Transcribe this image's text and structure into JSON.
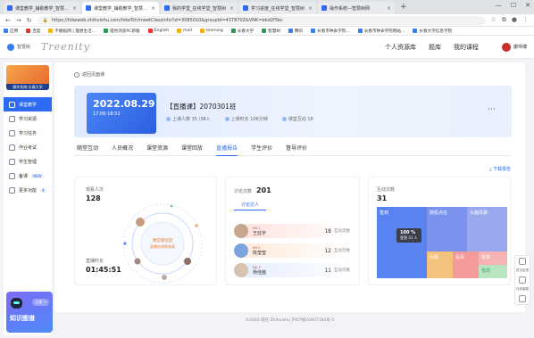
{
  "browser": {
    "tabs": [
      {
        "label": "课堂教学_辅助教学_智慧树网",
        "active": false
      },
      {
        "label": "课堂教学_辅助教学_智慧树网",
        "active": true
      },
      {
        "label": "我的学堂_在线学堂_智慧树",
        "active": false
      },
      {
        "label": "学习进度_在线学堂_智慧树",
        "active": false
      },
      {
        "label": "操作系统—智慧树网",
        "active": false
      }
    ],
    "new_tab": "+",
    "url": "https://hikeweb.zhihuishu.com/hikeTch/meetClassInfo?id=3085010&groupId=4378702&VNK=bbd2f5bc",
    "bookmarks": [
      "应用",
      "百度",
      "不搬稻网 | 理想生活...",
      "猎豹浏览PC新版",
      "English",
      "mail",
      "learning",
      "长春大学",
      "智慧树",
      "腾讯",
      "长春市钟表学院...",
      "长春市钟表学院网站...",
      "长春大学信息学院"
    ]
  },
  "topnav": {
    "logo_text": "智慧树",
    "brand": "Treenity",
    "links": [
      "个人资源库",
      "题库",
      "我的课程"
    ],
    "user_name": "康师傅"
  },
  "sidebar": {
    "course_label": "操作系统-长春大学",
    "items": [
      {
        "label": "课堂教学",
        "active": true,
        "badge": ""
      },
      {
        "label": "学习资源",
        "active": false,
        "badge": ""
      },
      {
        "label": "学习任务",
        "active": false,
        "badge": ""
      },
      {
        "label": "作业考试",
        "active": false,
        "badge": ""
      },
      {
        "label": "学生管理",
        "active": false,
        "badge": ""
      },
      {
        "label": "备课",
        "active": false,
        "badge": "NEW"
      },
      {
        "label": "更多功能",
        "active": false,
        "badge": "4"
      }
    ],
    "promo": {
      "title": "知识图谱",
      "go": "立即 >"
    }
  },
  "main": {
    "back_label": "返回见面课",
    "hero": {
      "date": "2022.08.29",
      "time": "17:06-18:52",
      "title": "【直播课】2070301班",
      "stats": [
        "上课人数 35 /38人",
        "上课时长 106分钟",
        "课堂互动 18"
      ],
      "more": "⋯"
    },
    "tabs": [
      {
        "label": "随堂互动",
        "active": false
      },
      {
        "label": "人员概况",
        "active": false
      },
      {
        "label": "课堂资源",
        "active": false
      },
      {
        "label": "课堂回放",
        "active": false
      },
      {
        "label": "直播报告",
        "active": true
      },
      {
        "label": "学生评价",
        "active": false
      },
      {
        "label": "督导评价",
        "active": false
      }
    ],
    "download": "下载报告",
    "card1": {
      "viewers_label": "观看人次",
      "viewers": "128",
      "duration_label": "直播时长",
      "duration": "01:45:51",
      "center_line1": "课堂受欢迎",
      "center_line2": "直播在线率很高"
    },
    "card2": {
      "label": "讨论次数",
      "count": "201",
      "subtab": "讨论达人",
      "ranks": [
        {
          "no": "NO.1",
          "name": "王廷宇",
          "score": "18",
          "unit": "互动次数"
        },
        {
          "no": "NO.2",
          "name": "陈莹莹",
          "score": "12",
          "unit": "互动次数"
        },
        {
          "no": "NO.3",
          "name": "杨佳茜",
          "score": "11",
          "unit": "互动次数"
        }
      ]
    },
    "card3": {
      "label": "互动次数",
      "count": "31",
      "tooltip_value": "100 %",
      "tooltip_text": "签到 31 人",
      "blocks": [
        "签到",
        "随机点名",
        "头脑风暴",
        "问卷",
        "投票",
        "抢答",
        "批改"
      ]
    }
  },
  "footer": "©2003-现在 Zhihuishu  沪ICP备10007183号-1",
  "right_tools": [
    "意见反馈",
    "在线客服"
  ],
  "colors": {
    "accent": "#2d6bf4",
    "treemap": [
      "#5a83f2",
      "#7c93ee",
      "#9aa8f0",
      "#f4c27f",
      "#f39a9a",
      "#f6b3b3",
      "#b9e6c0"
    ]
  }
}
